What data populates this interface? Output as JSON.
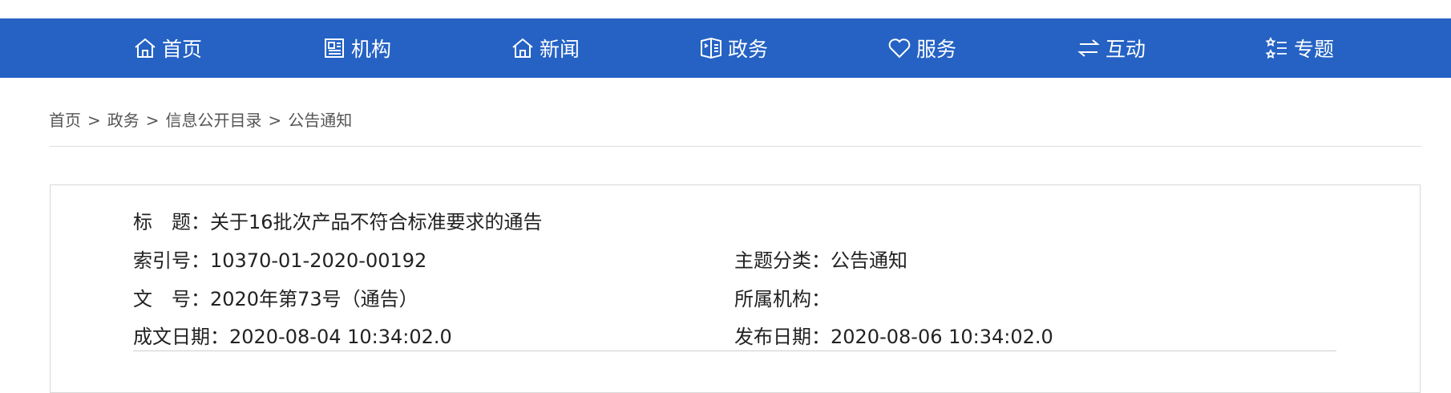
{
  "nav": {
    "items": [
      {
        "label": "首页",
        "icon": "home-icon"
      },
      {
        "label": "机构",
        "icon": "org-icon"
      },
      {
        "label": "新闻",
        "icon": "news-icon"
      },
      {
        "label": "政务",
        "icon": "gov-affairs-icon"
      },
      {
        "label": "服务",
        "icon": "heart-icon"
      },
      {
        "label": "互动",
        "icon": "exchange-icon"
      },
      {
        "label": "专题",
        "icon": "topics-icon"
      }
    ],
    "bg_color": "#2562c4"
  },
  "breadcrumb": {
    "items": [
      "首页",
      "政务",
      "信息公开目录",
      "公告通知"
    ],
    "separator": ">"
  },
  "info": {
    "title_label": "标　题：",
    "title_value": "关于16批次产品不符合标准要求的通告",
    "index_label": "索引号：",
    "index_value": "10370-01-2020-00192",
    "category_label": "主题分类：",
    "category_value": "公告通知",
    "docnum_label": "文　号：",
    "docnum_value": "2020年第73号（通告）",
    "org_label": "所属机构：",
    "org_value": "",
    "created_label": "成文日期：",
    "created_value": "2020-08-04 10:34:02.0",
    "published_label": "发布日期：",
    "published_value": "2020-08-06 10:34:02.0"
  }
}
